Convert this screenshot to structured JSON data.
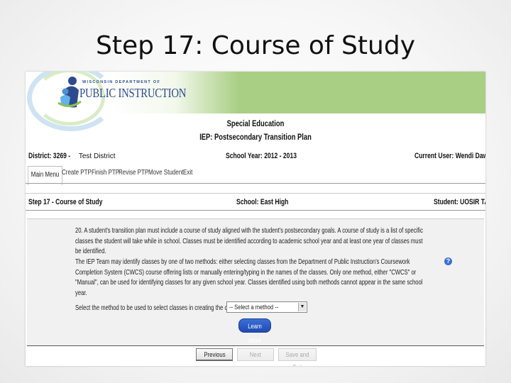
{
  "slide": {
    "title": "Step 17: Course of Study"
  },
  "logo": {
    "top_text": "WISCONSIN DEPARTMENT OF",
    "main_text": "PUBLIC INSTRUCTION"
  },
  "header": {
    "line1": "Special Education",
    "line2": "IEP: Postsecondary Transition Plan"
  },
  "meta": {
    "district_label": "District: 3269 -",
    "district_name": "Test District",
    "school_year": "School Year: 2012 - 2013",
    "current_user": "Current User: Wendi Dawson"
  },
  "tabs": [
    {
      "label": "Main Menu",
      "active": true
    },
    {
      "label": "Create PTP"
    },
    {
      "label": "Finish PTP"
    },
    {
      "label": "Revise PTP"
    },
    {
      "label": "Move Student"
    },
    {
      "label": "Exit"
    }
  ],
  "step_bar": {
    "step": "Step 17 - Course of Study",
    "school": "School: East High",
    "student": "Student: UOSIR TAGOE"
  },
  "content": {
    "para1": "20. A student's transition plan must include a course of study aligned with the student's postsecondary goals. A course of study is a list of specific classes the student will take while in school. Classes must be identified according to academic school year and at least one year of classes must be identified.",
    "para2": "The IEP Team may identify classes by one of two methods: either selecting classes from the Department of Public Instruction's Coursework Completion System (CWCS) course offering lists or manually entering/typing in the names of the classes. Only one method, either \"CWCS\" or \"Manual\", can be used for identifying classes for any given school year. Classes identified using both methods cannot appear in the same school year.",
    "help_icon": "?",
    "select_label": "Select the method to be used to select classes in creating the course of study.",
    "select_value": "-- Select a method --",
    "learn_more": "Learn More"
  },
  "footer": {
    "previous": "Previous",
    "next": "Next",
    "save_exit": "Save and Exit"
  }
}
